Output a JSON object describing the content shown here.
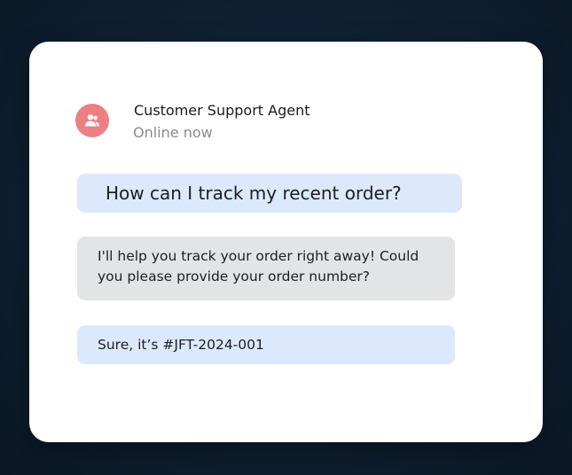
{
  "header": {
    "agent_name": "Customer Support Agent",
    "status": "Online now",
    "avatar_icon": "users-icon",
    "avatar_color": "#ec7f84"
  },
  "messages": [
    {
      "sender": "user",
      "text": "How can I track my recent order?"
    },
    {
      "sender": "agent",
      "text": "I'll help you track your order right away! Could you please provide your order number?"
    },
    {
      "sender": "user",
      "text": "Sure, it’s #JFT-2024-001"
    }
  ],
  "colors": {
    "user_bubble": "#dce9fd",
    "agent_bubble": "#e3e4e6",
    "background": "#0f2033"
  }
}
